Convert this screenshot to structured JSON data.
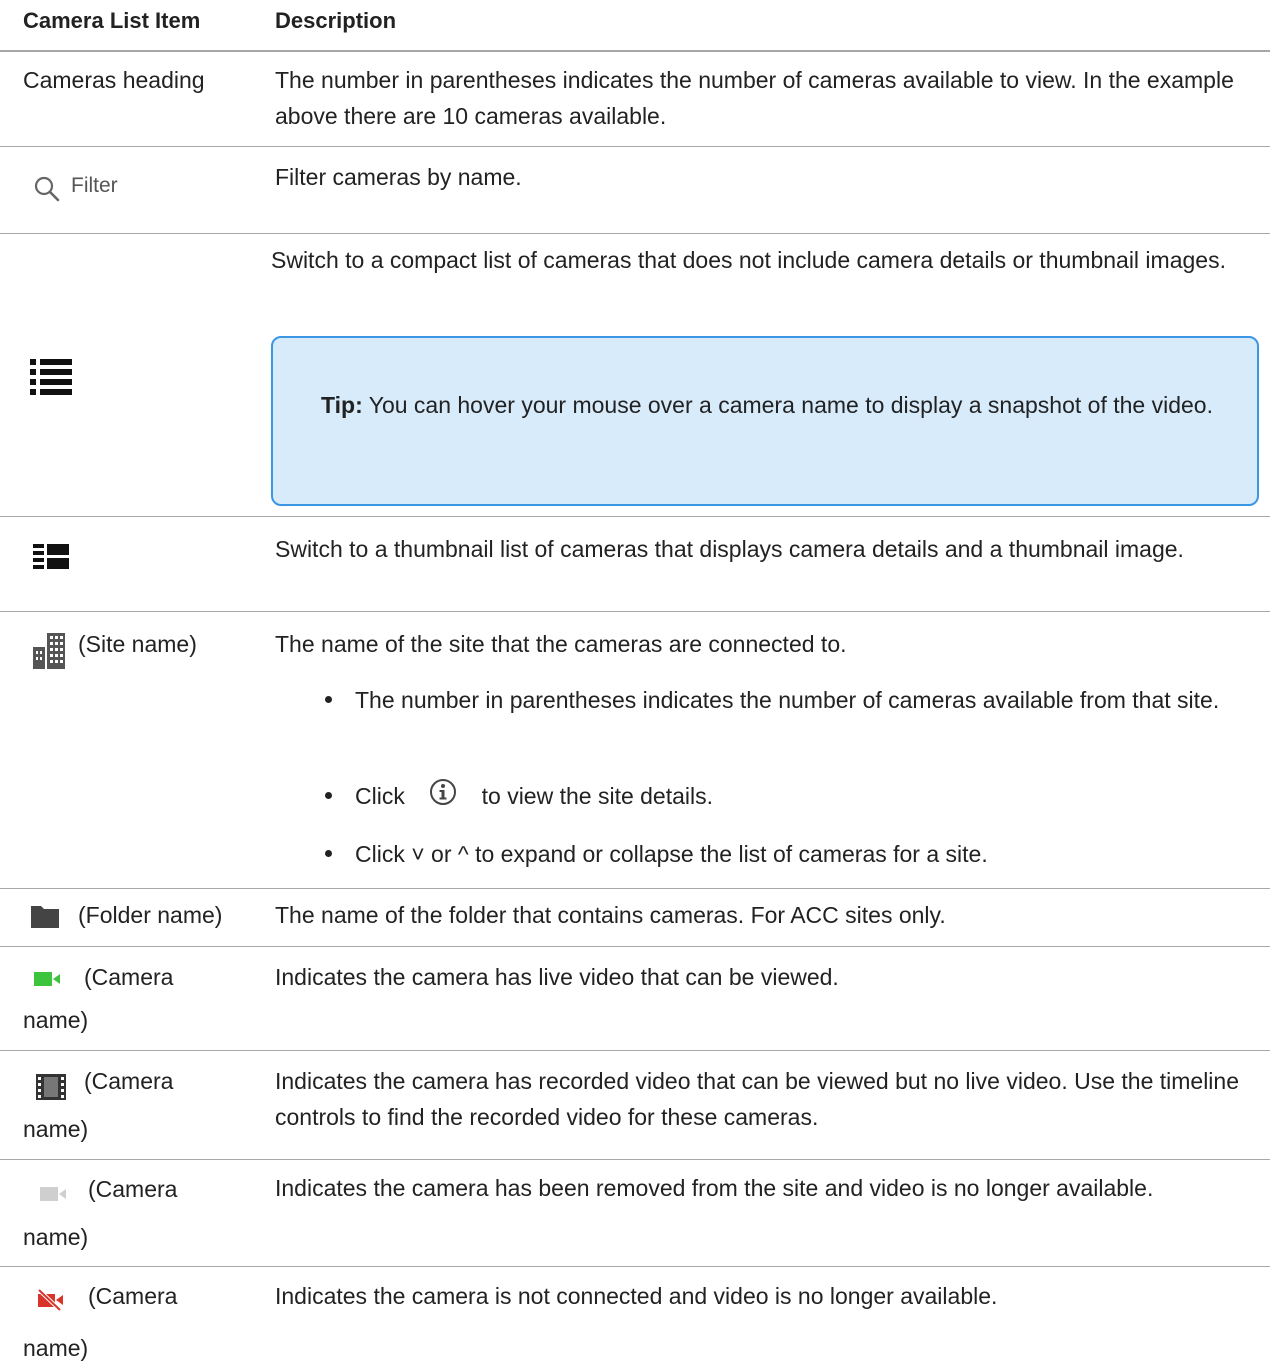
{
  "header": {
    "col_item": "Camera List Item",
    "col_desc": "Description"
  },
  "rows": {
    "cameras": {
      "item": "Cameras heading",
      "desc": "The number in parentheses indicates the number of cameras available to view. In the example above there are 10 cameras available."
    },
    "filter": {
      "item": "Filter",
      "desc": "Filter cameras by name."
    },
    "compact": {
      "desc": "Switch to a compact list of cameras that does not include camera details or thumbnail images.",
      "tip_label": "Tip:",
      "tip_text": "You can hover your mouse over a camera name to display a snapshot of the video."
    },
    "thumb": {
      "desc": "Switch to a thumbnail list of cameras that displays camera details and a thumbnail image."
    },
    "site": {
      "item": "(Site name)",
      "desc": "The name of the site that the cameras are connected to.",
      "bullet1": "The number in parentheses indicates the number of cameras available from that site.",
      "bullet2_a": "Click",
      "bullet2_b": "to view the site details.",
      "bullet3": "Click ˅ or ^ to expand or collapse the list of cameras for a site."
    },
    "folder": {
      "item": "(Folder name)",
      "desc": "The name of the folder that contains cameras. For ACC sites only."
    },
    "live": {
      "item_a": "(Camera",
      "item_b": "name)",
      "desc": "Indicates the camera has live video that can be viewed."
    },
    "recorded": {
      "item_a": "(Camera",
      "item_b": "name)",
      "desc": "Indicates the camera has recorded video that can be viewed but no live video. Use the timeline controls to find the recorded video for these cameras."
    },
    "removed": {
      "item_a": "(Camera",
      "item_b": "name)",
      "desc": "Indicates the camera has been removed from the site and video is no longer available."
    },
    "disconnected": {
      "item_a": "(Camera",
      "item_b": "name)",
      "desc": "Indicates the camera is not connected and video is no longer available."
    }
  },
  "colors": {
    "live_green": "#3cc43c",
    "disconnected_red": "#d9342b",
    "tip_bg": "#d7ebfb",
    "tip_border": "#3b96e3"
  }
}
